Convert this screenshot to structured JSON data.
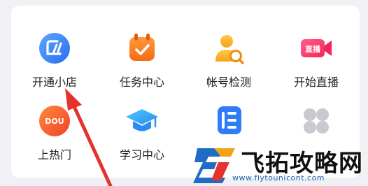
{
  "grid": {
    "items": [
      {
        "label": "开通小店",
        "icon": "store-icon"
      },
      {
        "label": "任务中心",
        "icon": "task-calendar-icon"
      },
      {
        "label": "帐号检测",
        "icon": "account-check-icon"
      },
      {
        "label": "开始直播",
        "icon": "live-camera-icon"
      },
      {
        "label": "上热门",
        "icon": "dou-plus-icon"
      },
      {
        "label": "学习中心",
        "icon": "graduation-cap-icon"
      },
      {
        "label": "",
        "icon": "doc-list-icon"
      },
      {
        "label": "",
        "icon": "more-apps-icon"
      }
    ],
    "icon_texts": {
      "live_badge": "直播",
      "dou_badge": "DOU"
    }
  },
  "watermark": {
    "title": "飞拓攻略网",
    "url": "www.fiytounicont.com"
  },
  "colors": {
    "accent_red": "#e5322d",
    "brand_blue": "#2f7df6"
  }
}
